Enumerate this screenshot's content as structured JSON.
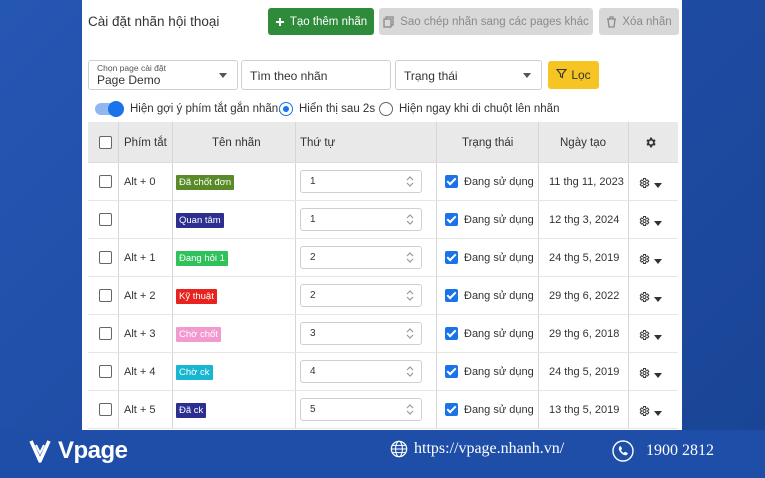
{
  "header": {
    "title": "Cài đặt nhãn hội thoại",
    "create_label": "Tạo thêm nhãn",
    "copy_label": "Sao chép nhãn sang các pages khác",
    "delete_label": "Xóa nhãn"
  },
  "filters": {
    "page_select_caption": "Chọn page cài đặt",
    "page_select_value": "Page Demo",
    "search_placeholder": "Tìm theo nhãn",
    "status_select_value": "Trạng thái",
    "filter_label": "Lọc"
  },
  "options": {
    "toggle_label": "Hiện gợi ý phím tắt gắn nhãn.",
    "toggle_on": true,
    "radio_delay_label": "Hiển thị sau 2s",
    "radio_hover_label": "Hiện ngay khi di chuột lên nhãn",
    "selected_radio": "delay"
  },
  "table": {
    "headers": {
      "shortcut": "Phím tắt",
      "label": "Tên nhãn",
      "order": "Thứ tự",
      "status": "Trạng thái",
      "created": "Ngày tạo"
    },
    "rows": [
      {
        "shortcut": "Alt + 0",
        "label": "Đã chốt đơn",
        "color": "#5a8a28",
        "order": "1",
        "status": "Đang sử dụng",
        "created": "11 thg 11, 2023"
      },
      {
        "shortcut": "",
        "label": "Quan tâm",
        "color": "#2c2f8f",
        "order": "1",
        "status": "Đang sử dụng",
        "created": "12 thg 3, 2024"
      },
      {
        "shortcut": "Alt + 1",
        "label": "Đang hỏi 1",
        "color": "#2fc25a",
        "order": "2",
        "status": "Đang sử dụng",
        "created": "24 thg 5, 2019"
      },
      {
        "shortcut": "Alt + 2",
        "label": "Kỹ thuật",
        "color": "#e8231f",
        "order": "2",
        "status": "Đang sử dụng",
        "created": "29 thg 6, 2022"
      },
      {
        "shortcut": "Alt + 3",
        "label": "Chờ chốt",
        "color": "#f29ad0",
        "order": "3",
        "status": "Đang sử dụng",
        "created": "29 thg 6, 2018"
      },
      {
        "shortcut": "Alt + 4",
        "label": "Chờ ck",
        "color": "#19b6d2",
        "order": "4",
        "status": "Đang sử dụng",
        "created": "24 thg 5, 2019"
      },
      {
        "shortcut": "Alt + 5",
        "label": "Đã ck",
        "color": "#2c2f8f",
        "order": "5",
        "status": "Đang sử dụng",
        "created": "13 thg 5, 2019"
      }
    ]
  },
  "footer": {
    "brand": "Vpage",
    "website": "https://vpage.nhanh.vn/",
    "phone": "1900 2812"
  },
  "colors": {
    "primary_green": "#2e8b3a",
    "filter_yellow": "#f6c523",
    "accent_blue": "#1a73e8",
    "brand_blue": "#1e4ea8"
  }
}
